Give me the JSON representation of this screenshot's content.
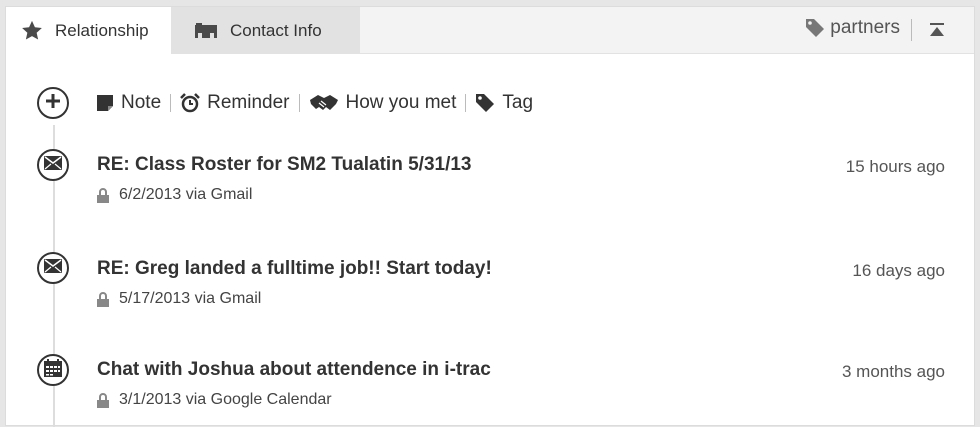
{
  "tabs": [
    {
      "label": "Relationship",
      "icon": "star-icon",
      "active": true
    },
    {
      "label": "Contact Info",
      "icon": "card-icon",
      "active": false
    }
  ],
  "header": {
    "tag_label": "partners",
    "tag_icon": "tag-icon",
    "collapse_icon": "collapse-icon"
  },
  "actions": [
    {
      "label": "Note",
      "icon": "note-icon"
    },
    {
      "label": "Reminder",
      "icon": "alarm-clock-icon"
    },
    {
      "label": "How you met",
      "icon": "handshake-icon"
    },
    {
      "label": "Tag",
      "icon": "tag-icon"
    }
  ],
  "entries": [
    {
      "icon": "envelope-icon",
      "title": "RE: Class Roster for SM2 Tualatin 5/31/13",
      "meta": "6/2/2013 via Gmail",
      "time": "15 hours ago"
    },
    {
      "icon": "envelope-icon",
      "title": "RE: Greg landed a fulltime job!! Start today!",
      "meta": "5/17/2013 via Gmail",
      "time": "16 days ago"
    },
    {
      "icon": "calendar-icon",
      "title": "Chat with Joshua about attendence in i-trac",
      "meta": "3/1/2013 via Google Calendar",
      "time": "3 months ago"
    }
  ],
  "colors": {
    "text": "#333333",
    "tab_active_bg": "#ffffff",
    "tab_inactive_bg": "#e2e2e2",
    "page_bg": "#e6e6e6"
  }
}
